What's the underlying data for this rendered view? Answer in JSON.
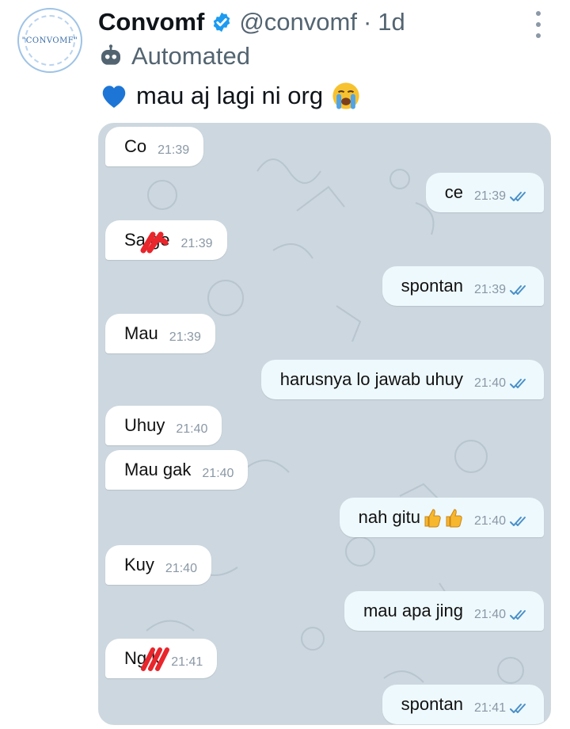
{
  "tweet": {
    "display_name": "Convomf",
    "handle": "@convomf",
    "separator": "·",
    "age": "1d",
    "label": "Automated",
    "text": "mau aj lagi ni org",
    "avatar_text": "\"CONVOMF\"",
    "colors": {
      "verified": "#1d9bf0",
      "heart": "#1d76d6",
      "handle": "#536471"
    }
  },
  "chat": {
    "messages": [
      {
        "dir": "in",
        "text": "Co",
        "time": "21:39"
      },
      {
        "dir": "out",
        "text": "ce",
        "time": "21:39"
      },
      {
        "dir": "in",
        "text": "Sa  ge",
        "time": "21:39"
      },
      {
        "dir": "out",
        "text": "spontan",
        "time": "21:39"
      },
      {
        "dir": "in",
        "text": "Mau",
        "time": "21:39"
      },
      {
        "dir": "out",
        "text": "harusnya lo jawab uhuy",
        "time": "21:40"
      },
      {
        "dir": "in",
        "text": "Uhuy",
        "time": "21:40"
      },
      {
        "dir": "in",
        "text": "Mau gak",
        "time": "21:40"
      },
      {
        "dir": "out",
        "text": "nah gitu",
        "time": "21:40"
      },
      {
        "dir": "in",
        "text": "Kuy",
        "time": "21:40"
      },
      {
        "dir": "out",
        "text": "mau apa jing",
        "time": "21:40"
      },
      {
        "dir": "in",
        "text": "Ng    k",
        "time": "21:41"
      },
      {
        "dir": "out",
        "text": "spontan",
        "time": "21:41"
      }
    ],
    "colors": {
      "background": "#ccd7df",
      "incoming": "#ffffff",
      "outgoing": "#eef9fd",
      "ticks": "#4a90c9",
      "redaction": "#e8262c"
    }
  }
}
